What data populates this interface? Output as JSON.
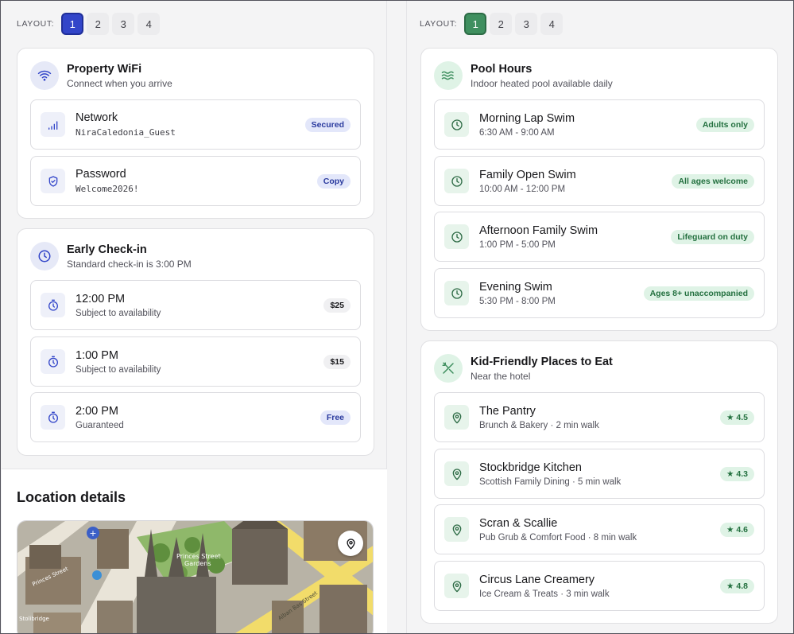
{
  "left_panel": {
    "layout": {
      "label": "LAYOUT:",
      "options": [
        "1",
        "2",
        "3",
        "4"
      ],
      "active": "1"
    },
    "wifi_card": {
      "title": "Property WiFi",
      "subtitle": "Connect when you arrive",
      "rows": [
        {
          "title": "Network",
          "value": "NiraCaledonia_Guest",
          "badge": "Secured",
          "icon": "signal-icon"
        },
        {
          "title": "Password",
          "value": "Welcome2026!",
          "badge": "Copy",
          "icon": "shield-icon"
        }
      ]
    },
    "checkin_card": {
      "title": "Early Check-in",
      "subtitle": "Standard check-in is 3:00 PM",
      "rows": [
        {
          "title": "12:00 PM",
          "sub": "Subject to availability",
          "badge": "$25",
          "icon": "stopwatch-icon"
        },
        {
          "title": "1:00 PM",
          "sub": "Subject to availability",
          "badge": "$15",
          "icon": "stopwatch-icon"
        },
        {
          "title": "2:00 PM",
          "sub": "Guaranteed",
          "badge": "Free",
          "icon": "stopwatch-icon"
        }
      ]
    },
    "location": {
      "title": "Location details",
      "map_labels": [
        "Princes Street",
        "Gardens",
        "Princes Street",
        "Alban Bas Street",
        "Stolibridge"
      ]
    }
  },
  "right_panel": {
    "layout": {
      "label": "LAYOUT:",
      "options": [
        "1",
        "2",
        "3",
        "4"
      ],
      "active": "1"
    },
    "pool_card": {
      "title": "Pool Hours",
      "subtitle": "Indoor heated pool available daily",
      "rows": [
        {
          "title": "Morning Lap Swim",
          "sub": "6:30 AM - 9:00 AM",
          "badge": "Adults only"
        },
        {
          "title": "Family Open Swim",
          "sub": "10:00 AM - 12:00 PM",
          "badge": "All ages welcome"
        },
        {
          "title": "Afternoon Family Swim",
          "sub": "1:00 PM - 5:00 PM",
          "badge": "Lifeguard on duty"
        },
        {
          "title": "Evening Swim",
          "sub": "5:30 PM - 8:00 PM",
          "badge": "Ages 8+ unaccompanied"
        }
      ]
    },
    "food_card": {
      "title": "Kid-Friendly Places to Eat",
      "subtitle": "Near the hotel",
      "rows": [
        {
          "title": "The Pantry",
          "sub": "Brunch & Bakery · 2 min walk",
          "rating": "4.5"
        },
        {
          "title": "Stockbridge Kitchen",
          "sub": "Scottish Family Dining · 5 min walk",
          "rating": "4.3"
        },
        {
          "title": "Scran & Scallie",
          "sub": "Pub Grub & Comfort Food · 8 min walk",
          "rating": "4.6"
        },
        {
          "title": "Circus Lane Creamery",
          "sub": "Ice Cream & Treats · 3 min walk",
          "rating": "4.8"
        }
      ]
    }
  },
  "colors": {
    "blue_accent": "#3245c9",
    "green_accent": "#3f8f5f",
    "badge_blue_text": "#2a3a9e",
    "badge_green_text": "#23703f"
  }
}
